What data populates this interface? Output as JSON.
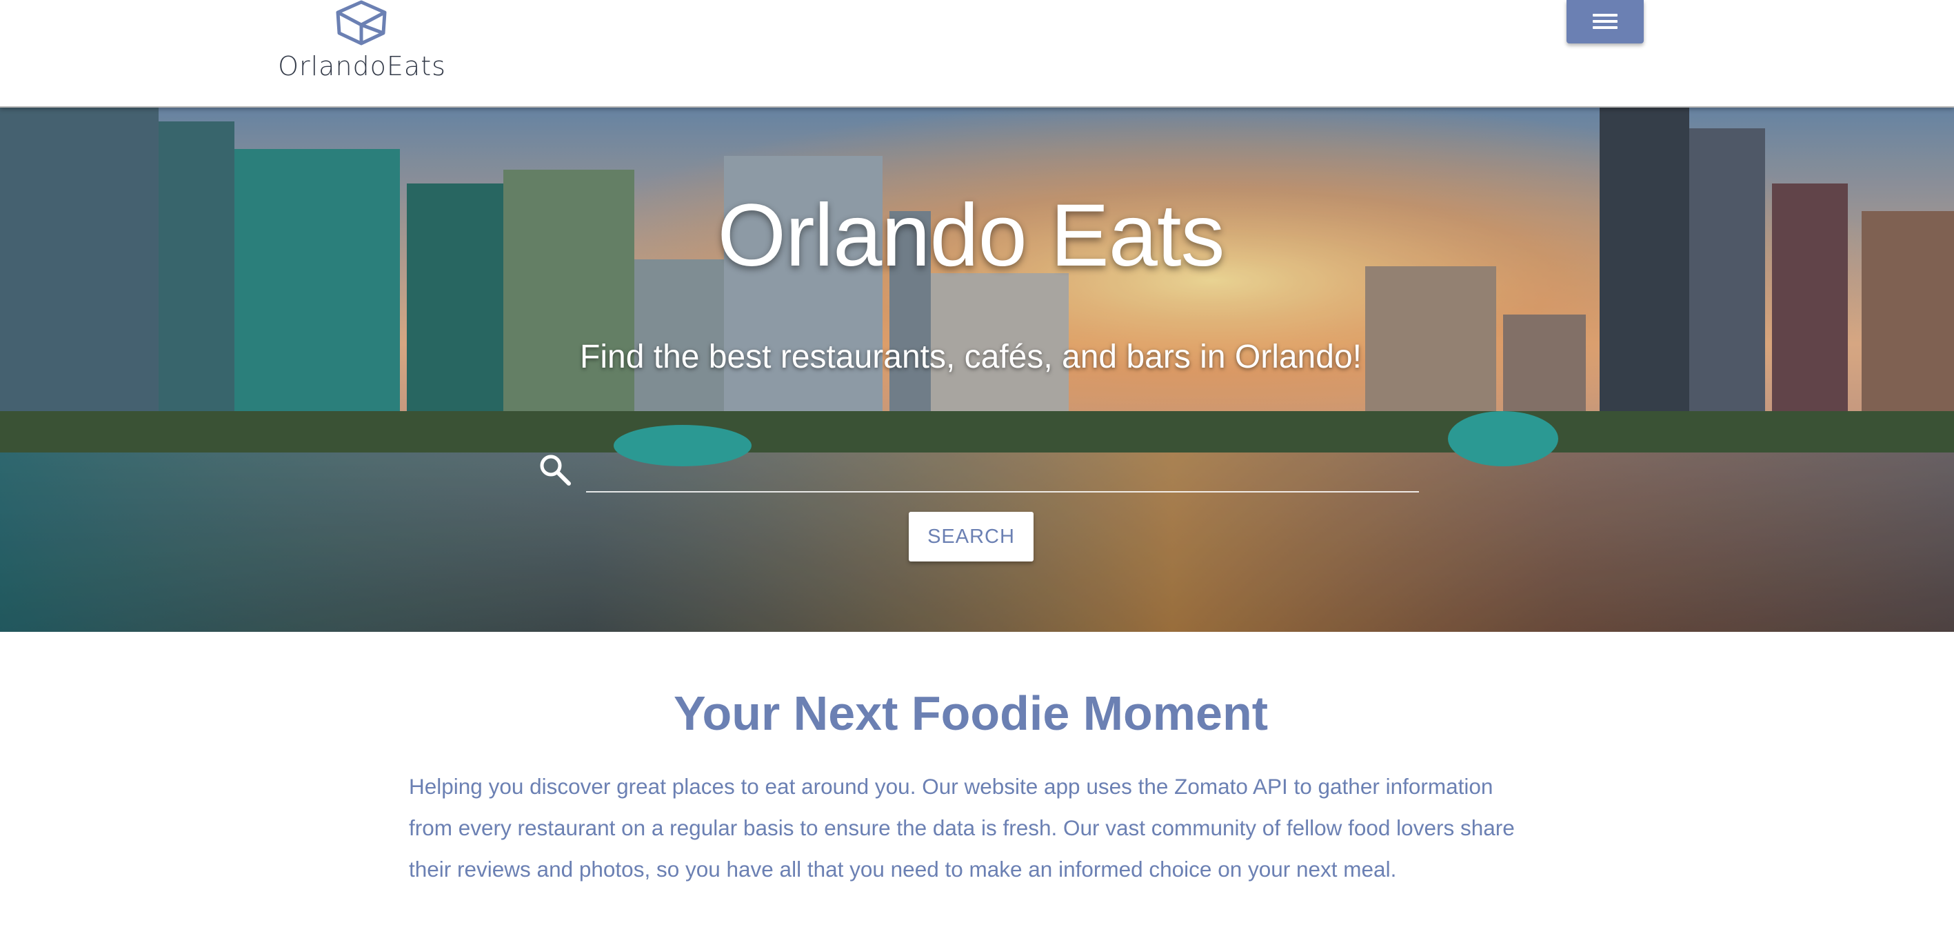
{
  "header": {
    "logo_text": "OrlandoEats",
    "menu_icon": "hamburger-menu-icon",
    "logo_icon": "cube-logo-icon",
    "accent_color": "#6b80b3"
  },
  "hero": {
    "title": "Orlando Eats",
    "subtitle": "Find the best restaurants, cafés, and bars in Orlando!",
    "search": {
      "icon": "search-icon",
      "value": "",
      "placeholder": "",
      "button_label": "SEARCH"
    },
    "background": "Orlando skyline reflected in Lake Eola at sunset"
  },
  "content": {
    "title": "Your Next Foodie Moment",
    "body": "Helping you discover great places to eat around you. Our website app uses the Zomato API to gather information from every restaurant on a regular basis to ensure the data is fresh. Our vast community of fellow food lovers share their reviews and photos, so you have all that you need to make an informed choice on your next  meal."
  }
}
